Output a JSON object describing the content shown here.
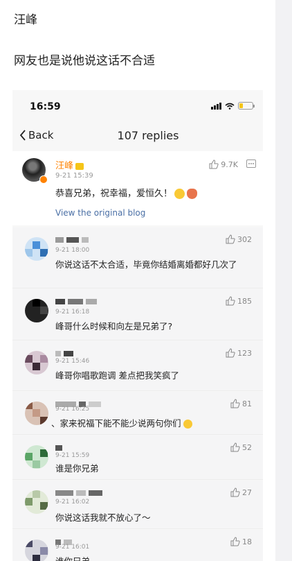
{
  "post": {
    "author": "汪峰",
    "caption": "网友也是说他说这话不合适"
  },
  "phone": {
    "status_time": "16:59",
    "battery_level": 0.25,
    "back_label": "Back",
    "title": "107 replies"
  },
  "original": {
    "name": "汪峰",
    "time": "9-21 15:39",
    "likes": "9.7K",
    "text": "恭喜兄弟，祝幸福，爱恒久！",
    "link": "View the original blog"
  },
  "replies": [
    {
      "time": "9-21 18:00",
      "likes": "302",
      "text": "你说这话不太合适，毕竟你结婚离婚都好几次了"
    },
    {
      "time": "9-21 16:18",
      "likes": "185",
      "text": "峰哥什么时候和向左是兄弟了?"
    },
    {
      "time": "9-21 15:46",
      "likes": "123",
      "text": "峰哥你唱歌跑调 差点把我笑疯了"
    },
    {
      "time": "9-21 16:25",
      "likes": "81",
      "text": "、家来祝福下能不能少说两句你们"
    },
    {
      "time": "9-21 15:59",
      "likes": "52",
      "text": "谁是你兄弟"
    },
    {
      "time": "9-21 16:02",
      "likes": "27",
      "text": "你说这话我就不放心了～"
    },
    {
      "time": "9-21 16:01",
      "likes": "18",
      "text": "谁你兄弟"
    }
  ],
  "colors": {
    "accent_orange": "#ff8200",
    "link_blue": "#4a6fa5"
  }
}
